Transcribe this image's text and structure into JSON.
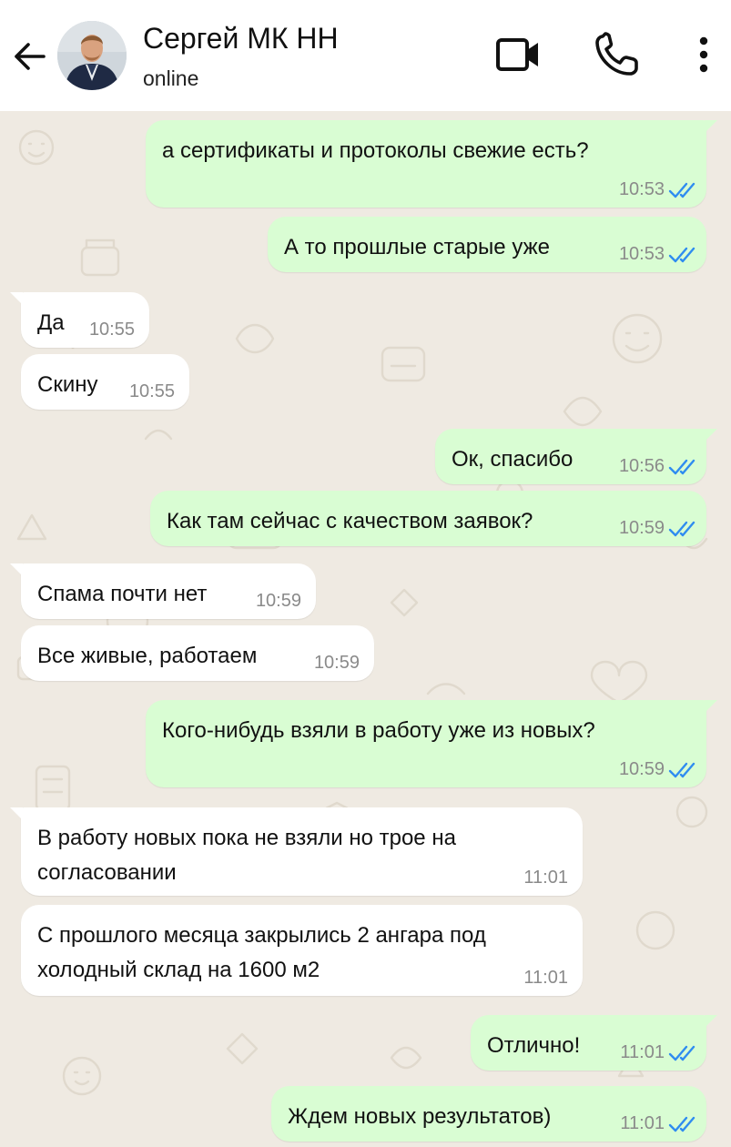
{
  "header": {
    "back_icon": "arrow-left-icon",
    "contact_name": "Сергей МК НН",
    "status": "online",
    "actions": [
      "video-call-icon",
      "phone-icon",
      "more-vertical-icon"
    ]
  },
  "colors": {
    "header_bg": "#ffffff",
    "chat_bg": "#efeae2",
    "outgoing_bubble": "#d9fdd3",
    "incoming_bubble": "#ffffff",
    "read_ticks": "#2f8cf0",
    "timestamp": "#8a8a8a"
  },
  "messages": [
    {
      "direction": "out",
      "text": "а сертификаты и протоколы свежие есть?",
      "time": "10:53",
      "read": true
    },
    {
      "direction": "out",
      "text": "А то прошлые старые уже",
      "time": "10:53",
      "read": true
    },
    {
      "direction": "in",
      "text": "Да",
      "time": "10:55"
    },
    {
      "direction": "in",
      "text": "Скину",
      "time": "10:55"
    },
    {
      "direction": "out",
      "text": "Ок, спасибо",
      "time": "10:56",
      "read": true
    },
    {
      "direction": "out",
      "text": "Как там сейчас с качеством заявок?",
      "time": "10:59",
      "read": true
    },
    {
      "direction": "in",
      "text": "Спама почти нет",
      "time": "10:59"
    },
    {
      "direction": "in",
      "text": "Все живые, работаем",
      "time": "10:59"
    },
    {
      "direction": "out",
      "text": "Кого-нибудь взяли в работу уже из новых?",
      "time": "10:59",
      "read": true
    },
    {
      "direction": "in",
      "text": "В работу новых пока не взяли но трое на\nсогласовании",
      "time": "11:01"
    },
    {
      "direction": "in",
      "text": "С прошлого месяца закрылись 2 ангара под\nхолодный склад на 1600 м2",
      "time": "11:01"
    },
    {
      "direction": "out",
      "text": "Отлично!",
      "time": "11:01",
      "read": true
    },
    {
      "direction": "out",
      "text": "Ждем новых результатов)",
      "time": "11:01",
      "read": true
    }
  ]
}
